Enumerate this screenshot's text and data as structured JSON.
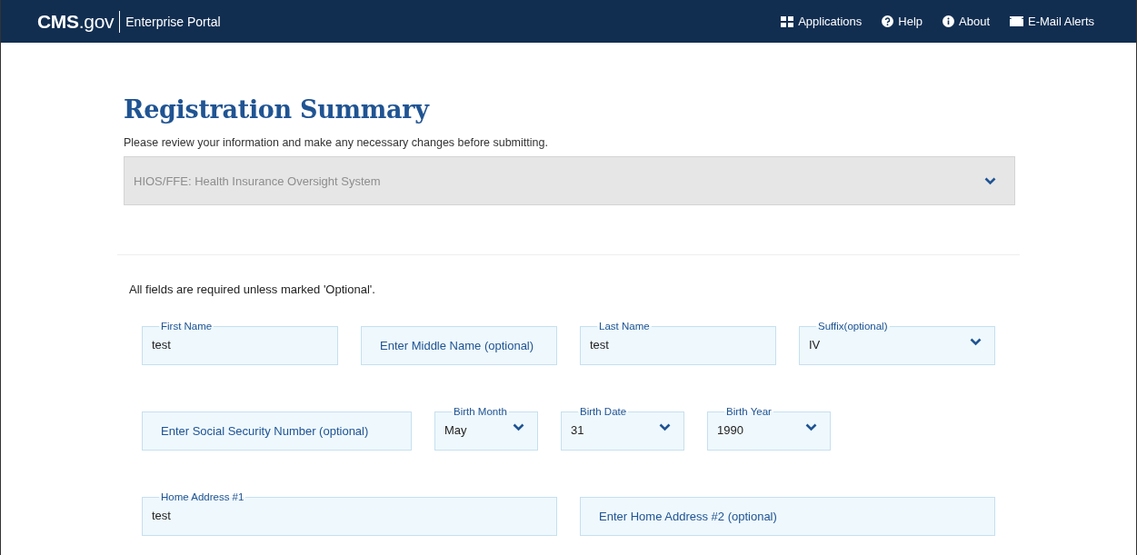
{
  "header": {
    "logo": "**CMS**.gov",
    "portal": "Enterprise Portal",
    "nav": [
      {
        "kind": "grid",
        "label": "Applications"
      },
      {
        "kind": "help",
        "label": "Help"
      },
      {
        "kind": "info",
        "label": "About"
      },
      {
        "kind": "mail",
        "label": "E-Mail Alerts"
      }
    ]
  },
  "title": "Registration Summary",
  "intro": "Please review your information and make any necessary changes before submitting.",
  "accordion": {
    "label": "HIOS/FFE: Health Insurance Oversight System",
    "expanded": false
  },
  "note": "All fields are required unless marked 'Optional'.",
  "rows": [
    [
      {
        "kind": "text",
        "label": "First Name",
        "value": "test"
      },
      {
        "kind": "text",
        "placeholder": "Enter Middle Name (optional)"
      },
      {
        "kind": "text",
        "label": "Last Name",
        "value": "test"
      },
      {
        "kind": "select",
        "label": "Suffix(optional)",
        "value": "IV"
      }
    ],
    [
      {
        "kind": "text",
        "placeholder": "Enter Social Security Number (optional)"
      },
      {
        "kind": "select",
        "label": "Birth Month",
        "value": "May"
      },
      {
        "kind": "select",
        "label": "Birth Date",
        "value": "31"
      },
      {
        "kind": "select",
        "label": "Birth Year",
        "value": "1990"
      }
    ],
    [
      {
        "kind": "text",
        "label": "Home Address #1",
        "value": "test"
      },
      {
        "kind": "text",
        "placeholder": "Enter Home Address #2 (optional)"
      }
    ]
  ]
}
